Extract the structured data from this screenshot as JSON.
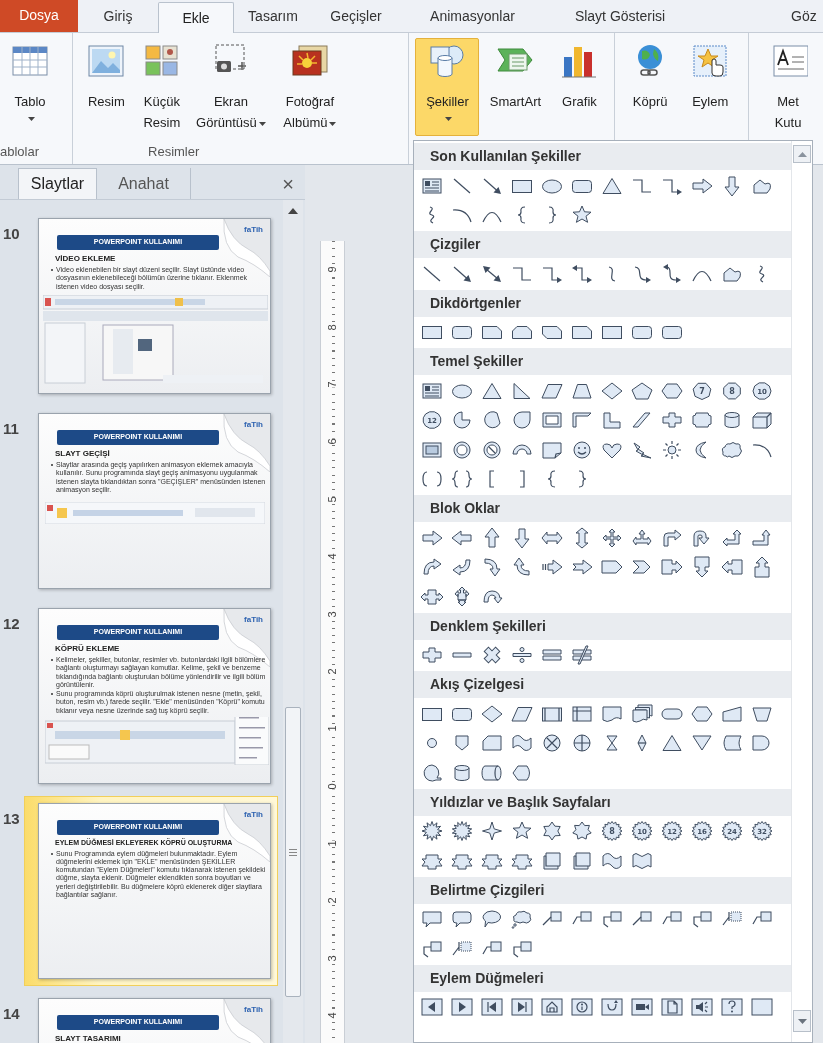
{
  "ribbon_tabs": [
    {
      "label": "Dosya",
      "kind": "file",
      "selected": false
    },
    {
      "label": "Giriş",
      "kind": "tab",
      "selected": false
    },
    {
      "label": "Ekle",
      "kind": "tab",
      "selected": true
    },
    {
      "label": "Tasarım",
      "kind": "tab",
      "selected": false
    },
    {
      "label": "Geçişler",
      "kind": "tab",
      "selected": false
    },
    {
      "label": "Animasyonlar",
      "kind": "tab",
      "selected": false
    },
    {
      "label": "Slayt Gösterisi",
      "kind": "tab",
      "selected": false
    },
    {
      "label": "Göz",
      "kind": "tab",
      "selected": false
    }
  ],
  "ribbon_groups": [
    {
      "label": "ablolar",
      "buttons": [
        {
          "label": "Tablo",
          "kind": "table",
          "dropdown": true,
          "selected": false
        }
      ]
    },
    {
      "label": "Resimler",
      "buttons": [
        {
          "label": "Resim",
          "kind": "picture",
          "dropdown": false,
          "selected": false
        },
        {
          "label": "Küçük\nResim",
          "kind": "clipart",
          "dropdown": false,
          "selected": false
        },
        {
          "label": "Ekran\nGörüntüsü",
          "kind": "screenshot",
          "dropdown": true,
          "selected": false
        },
        {
          "label": "Fotoğraf\nAlbümü",
          "kind": "album",
          "dropdown": true,
          "selected": false
        }
      ]
    },
    {
      "buttons": [
        {
          "label": "Şekiller",
          "kind": "shapes",
          "dropdown": true,
          "selected": true
        },
        {
          "label": "SmartArt",
          "kind": "smartart",
          "dropdown": false,
          "selected": false
        },
        {
          "label": "Grafik",
          "kind": "chart",
          "dropdown": false,
          "selected": false
        }
      ]
    },
    {
      "buttons": [
        {
          "label": "Köprü",
          "kind": "hyperlink",
          "dropdown": false,
          "selected": false
        },
        {
          "label": "Eylem",
          "kind": "action",
          "dropdown": false,
          "selected": false
        }
      ]
    },
    {
      "buttons": [
        {
          "label": "Met\nKutu",
          "kind": "textbox",
          "dropdown": false,
          "selected": false
        }
      ]
    }
  ],
  "slide_pane": {
    "tabs": [
      {
        "label": "Slaytlar",
        "selected": true
      },
      {
        "label": "Anahat",
        "selected": false
      }
    ],
    "close": "×"
  },
  "slides": [
    {
      "number": "10",
      "selected": false,
      "logo": "faTih",
      "header": "POWERPOINT KULLANIMI",
      "title": "VİDEO EKLEME",
      "bullets": [
        "Video eklenebilen bir slayt düzeni seçilir. Slayt üstünde video dosyasının eklenebileceği bölümün üzerine tıklanır. Eklenmek istenen video dosyası seçilir."
      ],
      "kind": "large"
    },
    {
      "number": "11",
      "selected": false,
      "logo": "faTih",
      "header": "POWERPOINT KULLANIMI",
      "title": "SLAYT GEÇİŞİ",
      "bullets": [
        "Slaytlar arasında geçiş yapılırken animasyon eklemek amacıyla kullanılır. Sunu programında slayt geçiş animasyonu uygulanmak istenen slayta tıklandıktan sonra \"GEÇİŞLER\" menüsünden istenen animasyon seçilir."
      ],
      "kind": "strip"
    },
    {
      "number": "12",
      "selected": false,
      "logo": "faTih",
      "header": "POWERPOINT KULLANIMI",
      "title": "KÖPRÜ EKLEME",
      "bullets": [
        "Kelimeler, şekiller, butonlar, resimler vb. butonlardaki ilgili bölümlere bağlantı oluşturmayı sağlayan komutlar. Kelime, şekil ve benzeme tıklandığında bağlantı oluşturulan bölüme yönlendirilir ve ilgili bölüm görüntülenir.",
        "Sunu programında köprü oluşturulmak istenen nesne (metin, şekil, buton, resim vb.) farede seçilir. \"Ekle\" menüsünden \"Köprü\" komutu tıklanır veya nesne üzerinde sağ tuş köprü seçilir."
      ],
      "kind": "menu"
    },
    {
      "number": "13",
      "selected": true,
      "logo": "faTih",
      "header": "POWERPOINT KULLANIMI",
      "title": "EYLEM DÜĞMESİ EKLEYEREK KÖPRÜ OLUŞTURMA",
      "bullets": [
        "Sunu Programında eylem düğmeleri bulunmaktadır. Eylem düğmelerini eklemek için \"EKLE\" menüsünden ŞEKİLLER komutundan \"Eylem Düğmeleri\" komutu tıklanarak istenen şekildeki düğme, slayta eklenir. Düğmeler eklendikten sonra boyutları ve yerleri değiştirilebilir. Bu düğmelere köprü eklenerek diğer slaytlara bağlantılar sağlanır."
      ],
      "kind": "text"
    },
    {
      "number": "14",
      "selected": false,
      "logo": "faTih",
      "header": "POWERPOINT KULLANIMI",
      "title": "SLAYT TASARIMI",
      "kind": "text"
    }
  ],
  "ruler": {
    "labels": [
      "9",
      "8",
      "7",
      "6",
      "5",
      "4",
      "3",
      "2",
      "1",
      "0",
      "1",
      "2",
      "3",
      "4"
    ]
  },
  "shapes_gallery": {
    "sections": [
      {
        "title": "Son Kullanılan Şekiller"
      },
      {
        "title": "Çizgiler"
      },
      {
        "title": "Dikdörtgenler"
      },
      {
        "title": "Temel Şekiller",
        "badges": [
          "7",
          "8",
          "10",
          "12"
        ]
      },
      {
        "title": "Blok Oklar"
      },
      {
        "title": "Denklem Şekilleri"
      },
      {
        "title": "Akış Çizelgesi"
      },
      {
        "title": "Yıldızlar ve Başlık Sayfaları",
        "badges": [
          "8",
          "10",
          "12",
          "16",
          "24",
          "32"
        ]
      },
      {
        "title": "Belirtme Çizgileri"
      },
      {
        "title": "Eylem Düğmeleri"
      }
    ]
  }
}
